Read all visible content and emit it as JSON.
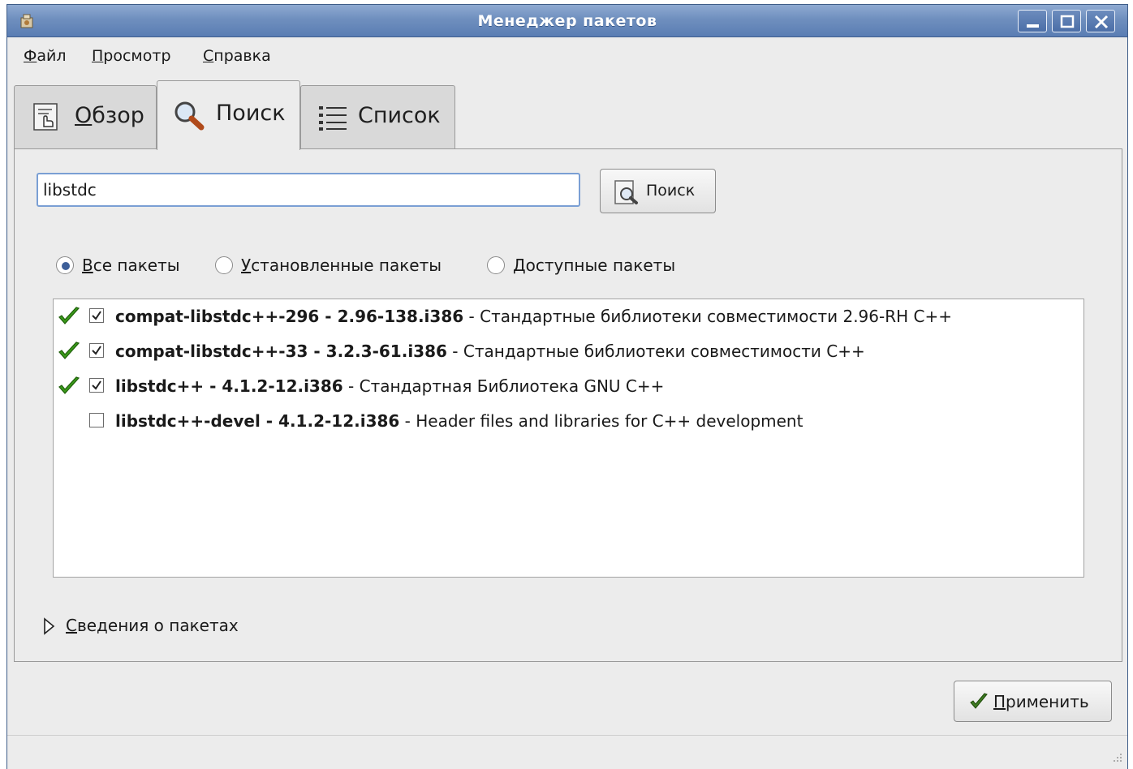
{
  "window": {
    "title": "Менеджер пакетов"
  },
  "menu": {
    "file": "Файл",
    "view": "Просмотр",
    "help": "Справка"
  },
  "tabs": [
    {
      "label": "Обзор",
      "icon": "overview-icon",
      "active": false
    },
    {
      "label": "Поиск",
      "icon": "magnifier-icon",
      "active": true
    },
    {
      "label": "Список",
      "icon": "list-icon",
      "active": false
    }
  ],
  "search": {
    "value": "libstdc",
    "button_label": "Поиск"
  },
  "filters": {
    "all": "Все пакеты",
    "installed": "Установленные пакеты",
    "available": "Доступные пакеты",
    "selected": "all"
  },
  "packages": [
    {
      "name": "compat-libstdc++-296 - 2.96-138.i386",
      "description": "Стандартные библиотеки совместимости 2.96-RH C++",
      "installed": true,
      "checked": true
    },
    {
      "name": "compat-libstdc++-33 - 3.2.3-61.i386",
      "description": "Стандартные библиотеки совместимости C++",
      "installed": true,
      "checked": true
    },
    {
      "name": "libstdc++ - 4.1.2-12.i386",
      "description": "Стандартная Библиотека GNU C++",
      "installed": true,
      "checked": true
    },
    {
      "name": "libstdc++-devel - 4.1.2-12.i386",
      "description": "Header files and libraries for C++ development",
      "installed": false,
      "checked": false
    }
  ],
  "details": {
    "label": "Сведения о пакетах",
    "expanded": false
  },
  "apply": {
    "label": "Применить"
  },
  "colors": {
    "titlebar": "#6f8fbe",
    "accent": "#3d5f99",
    "check_green": "#3a9a1a"
  }
}
